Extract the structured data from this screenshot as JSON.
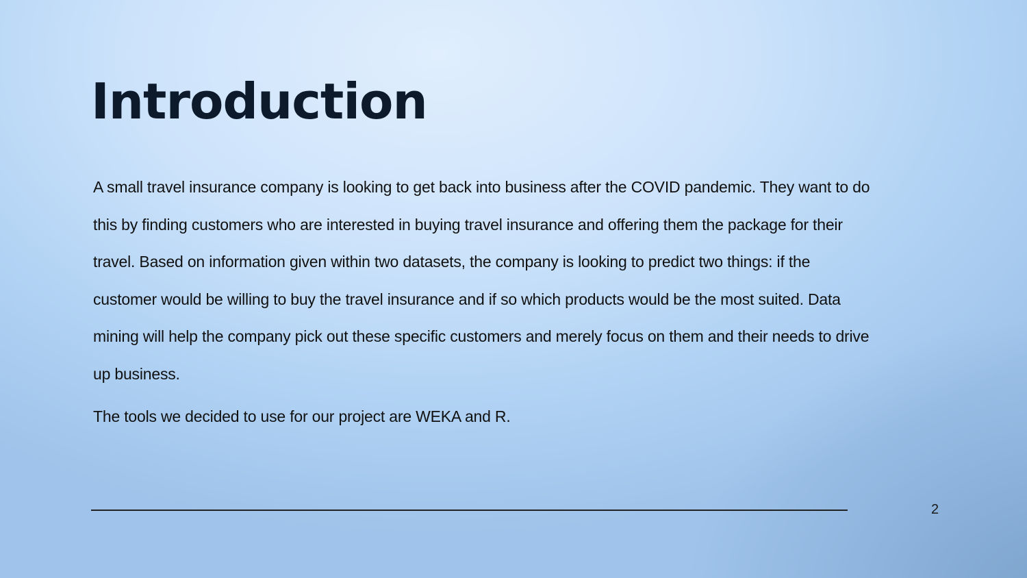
{
  "slide": {
    "title": "Introduction",
    "paragraphs": [
      "A small travel insurance company is looking to get back into business after the COVID pandemic. They want to do this by finding customers who are interested in buying travel insurance and offering them the package for their travel. Based on information given within two datasets, the company is looking to predict two things: if the customer would be willing to buy the travel insurance and if so which products would be the most suited. Data mining will help the company pick out these specific customers and merely focus on them and their needs to drive up business.",
      "The tools we decided to use for our project are WEKA and R."
    ],
    "page_number": "2"
  }
}
